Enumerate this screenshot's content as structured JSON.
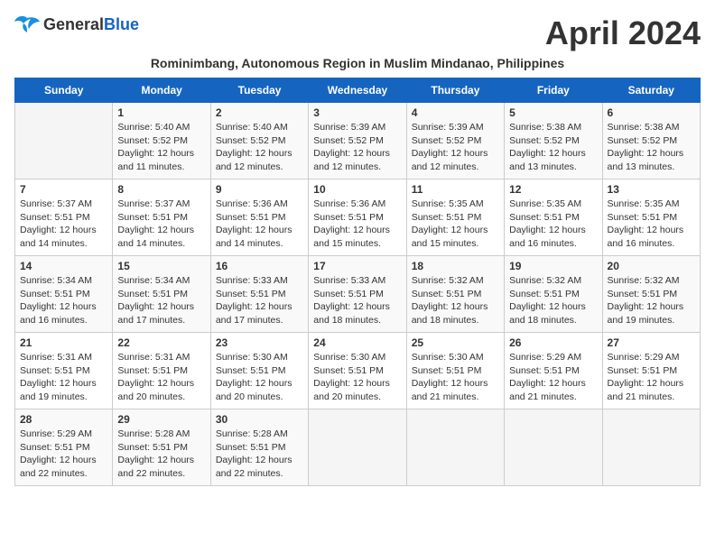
{
  "header": {
    "logo_general": "General",
    "logo_blue": "Blue",
    "month_title": "April 2024",
    "subtitle": "Rominimbang, Autonomous Region in Muslim Mindanao, Philippines"
  },
  "days_of_week": [
    "Sunday",
    "Monday",
    "Tuesday",
    "Wednesday",
    "Thursday",
    "Friday",
    "Saturday"
  ],
  "weeks": [
    [
      {
        "day": "",
        "info": ""
      },
      {
        "day": "1",
        "info": "Sunrise: 5:40 AM\nSunset: 5:52 PM\nDaylight: 12 hours\nand 11 minutes."
      },
      {
        "day": "2",
        "info": "Sunrise: 5:40 AM\nSunset: 5:52 PM\nDaylight: 12 hours\nand 12 minutes."
      },
      {
        "day": "3",
        "info": "Sunrise: 5:39 AM\nSunset: 5:52 PM\nDaylight: 12 hours\nand 12 minutes."
      },
      {
        "day": "4",
        "info": "Sunrise: 5:39 AM\nSunset: 5:52 PM\nDaylight: 12 hours\nand 12 minutes."
      },
      {
        "day": "5",
        "info": "Sunrise: 5:38 AM\nSunset: 5:52 PM\nDaylight: 12 hours\nand 13 minutes."
      },
      {
        "day": "6",
        "info": "Sunrise: 5:38 AM\nSunset: 5:52 PM\nDaylight: 12 hours\nand 13 minutes."
      }
    ],
    [
      {
        "day": "7",
        "info": "Sunrise: 5:37 AM\nSunset: 5:51 PM\nDaylight: 12 hours\nand 14 minutes."
      },
      {
        "day": "8",
        "info": "Sunrise: 5:37 AM\nSunset: 5:51 PM\nDaylight: 12 hours\nand 14 minutes."
      },
      {
        "day": "9",
        "info": "Sunrise: 5:36 AM\nSunset: 5:51 PM\nDaylight: 12 hours\nand 14 minutes."
      },
      {
        "day": "10",
        "info": "Sunrise: 5:36 AM\nSunset: 5:51 PM\nDaylight: 12 hours\nand 15 minutes."
      },
      {
        "day": "11",
        "info": "Sunrise: 5:35 AM\nSunset: 5:51 PM\nDaylight: 12 hours\nand 15 minutes."
      },
      {
        "day": "12",
        "info": "Sunrise: 5:35 AM\nSunset: 5:51 PM\nDaylight: 12 hours\nand 16 minutes."
      },
      {
        "day": "13",
        "info": "Sunrise: 5:35 AM\nSunset: 5:51 PM\nDaylight: 12 hours\nand 16 minutes."
      }
    ],
    [
      {
        "day": "14",
        "info": "Sunrise: 5:34 AM\nSunset: 5:51 PM\nDaylight: 12 hours\nand 16 minutes."
      },
      {
        "day": "15",
        "info": "Sunrise: 5:34 AM\nSunset: 5:51 PM\nDaylight: 12 hours\nand 17 minutes."
      },
      {
        "day": "16",
        "info": "Sunrise: 5:33 AM\nSunset: 5:51 PM\nDaylight: 12 hours\nand 17 minutes."
      },
      {
        "day": "17",
        "info": "Sunrise: 5:33 AM\nSunset: 5:51 PM\nDaylight: 12 hours\nand 18 minutes."
      },
      {
        "day": "18",
        "info": "Sunrise: 5:32 AM\nSunset: 5:51 PM\nDaylight: 12 hours\nand 18 minutes."
      },
      {
        "day": "19",
        "info": "Sunrise: 5:32 AM\nSunset: 5:51 PM\nDaylight: 12 hours\nand 18 minutes."
      },
      {
        "day": "20",
        "info": "Sunrise: 5:32 AM\nSunset: 5:51 PM\nDaylight: 12 hours\nand 19 minutes."
      }
    ],
    [
      {
        "day": "21",
        "info": "Sunrise: 5:31 AM\nSunset: 5:51 PM\nDaylight: 12 hours\nand 19 minutes."
      },
      {
        "day": "22",
        "info": "Sunrise: 5:31 AM\nSunset: 5:51 PM\nDaylight: 12 hours\nand 20 minutes."
      },
      {
        "day": "23",
        "info": "Sunrise: 5:30 AM\nSunset: 5:51 PM\nDaylight: 12 hours\nand 20 minutes."
      },
      {
        "day": "24",
        "info": "Sunrise: 5:30 AM\nSunset: 5:51 PM\nDaylight: 12 hours\nand 20 minutes."
      },
      {
        "day": "25",
        "info": "Sunrise: 5:30 AM\nSunset: 5:51 PM\nDaylight: 12 hours\nand 21 minutes."
      },
      {
        "day": "26",
        "info": "Sunrise: 5:29 AM\nSunset: 5:51 PM\nDaylight: 12 hours\nand 21 minutes."
      },
      {
        "day": "27",
        "info": "Sunrise: 5:29 AM\nSunset: 5:51 PM\nDaylight: 12 hours\nand 21 minutes."
      }
    ],
    [
      {
        "day": "28",
        "info": "Sunrise: 5:29 AM\nSunset: 5:51 PM\nDaylight: 12 hours\nand 22 minutes."
      },
      {
        "day": "29",
        "info": "Sunrise: 5:28 AM\nSunset: 5:51 PM\nDaylight: 12 hours\nand 22 minutes."
      },
      {
        "day": "30",
        "info": "Sunrise: 5:28 AM\nSunset: 5:51 PM\nDaylight: 12 hours\nand 22 minutes."
      },
      {
        "day": "",
        "info": ""
      },
      {
        "day": "",
        "info": ""
      },
      {
        "day": "",
        "info": ""
      },
      {
        "day": "",
        "info": ""
      }
    ]
  ]
}
